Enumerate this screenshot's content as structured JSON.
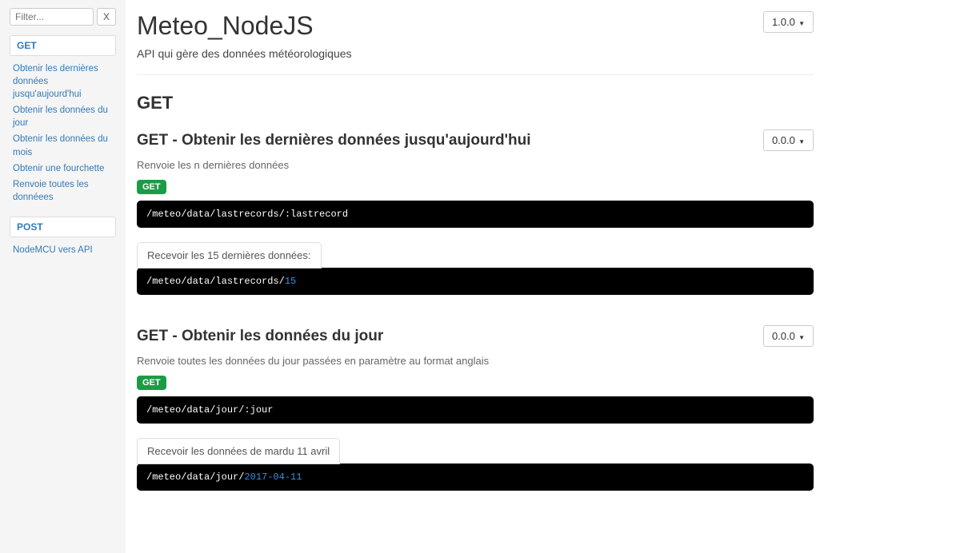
{
  "sidebar": {
    "filter_placeholder": "Filter...",
    "clear_label": "X",
    "groups": [
      {
        "method": "GET",
        "items": [
          "Obtenir les dernières données jusqu'aujourd'hui",
          "Obtenir les données du jour",
          "Obtenir les données du mois",
          "Obtenir une fourchette",
          "Renvoie toutes les donnéees"
        ]
      },
      {
        "method": "POST",
        "items": [
          "NodeMCU vers API"
        ]
      }
    ]
  },
  "header": {
    "title": "Meteo_NodeJS",
    "subtitle": "API qui gère des données météorologiques",
    "version": "1.0.0"
  },
  "section_title": "GET",
  "endpoints": [
    {
      "title": "GET - Obtenir les dernières données jusqu'aujourd'hui",
      "version": "0.0.0",
      "description": "Renvoie les n dernières données",
      "method": "GET",
      "path_plain": "/meteo/data/lastrecords/:lastrecord",
      "example_tab": "Recevoir les 15 dernières données:",
      "example_path_prefix": "/meteo/data/lastrecords/",
      "example_param": "15"
    },
    {
      "title": "GET - Obtenir les données du jour",
      "version": "0.0.0",
      "description": "Renvoie toutes les données du jour passées en paramètre au format anglais",
      "method": "GET",
      "path_plain": "/meteo/data/jour/:jour",
      "example_tab": "Recevoir les données de mardu 11 avril",
      "example_path_prefix": "/meteo/data/jour/",
      "example_param": "2017-04-11"
    }
  ]
}
